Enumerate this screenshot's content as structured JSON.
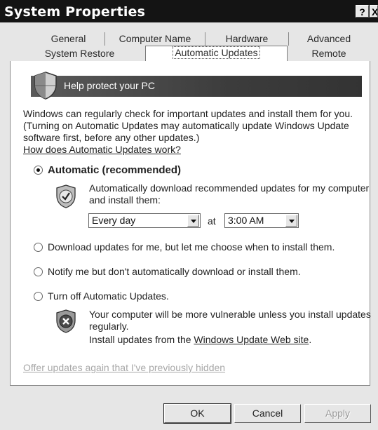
{
  "window": {
    "title": "System Properties",
    "help_button": "?",
    "close_button": "X"
  },
  "tabs": {
    "row1": [
      "General",
      "Computer Name",
      "Hardware",
      "Advanced"
    ],
    "row2": [
      "System Restore",
      "Automatic Updates",
      "Remote"
    ],
    "active": "Automatic Updates"
  },
  "banner": {
    "text": "Help protect your PC",
    "icon": "shield-icon"
  },
  "intro": {
    "line1": "Windows can regularly check for important updates and install them for you.",
    "line2": "(Turning on Automatic Updates may automatically update Windows Update",
    "line3": "software first, before any other updates.)",
    "link": "How does Automatic Updates work?"
  },
  "options": {
    "automatic": {
      "label": "Automatic (recommended)",
      "desc1": "Automatically download recommended updates for my computer",
      "desc2": "and install them:",
      "frequency": "Every day",
      "at_label": "at",
      "time": "3:00 AM",
      "icon": "shield-check-icon",
      "selected": true
    },
    "download": {
      "label": "Download updates for me, but let me choose when to install them.",
      "selected": false
    },
    "notify": {
      "label": "Notify me but don't automatically download or install them.",
      "selected": false
    },
    "turn_off": {
      "label": "Turn off Automatic Updates.",
      "desc1": "Your computer will be more vulnerable unless you install updates",
      "desc2": "regularly.",
      "desc3_prefix": "Install updates from the",
      "desc3_link": "Windows Update Web site",
      "desc3_suffix": ".",
      "icon": "shield-x-icon",
      "selected": false
    }
  },
  "hidden_link": "Offer updates again that I've previously hidden",
  "buttons": {
    "ok": "OK",
    "cancel": "Cancel",
    "apply": "Apply"
  }
}
